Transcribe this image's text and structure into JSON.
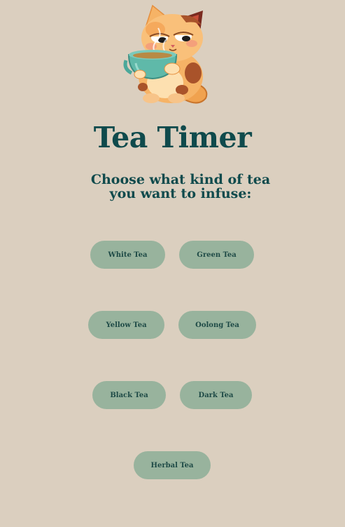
{
  "title": "Tea Timer",
  "subtitle": "Choose what kind of tea you want to infuse:",
  "teas": {
    "white": "White Tea",
    "green": "Green Tea",
    "yellow": "Yellow Tea",
    "oolong": "Oolong Tea",
    "black": "Black Tea",
    "dark": "Dark Tea",
    "herbal": "Herbal Tea"
  },
  "colors": {
    "background": "#dbcfbf",
    "heading": "#0f4a4c",
    "button": "#98b39d",
    "button_text": "#1e4a46"
  },
  "icons": {
    "mascot": "cat-with-tea-cup-icon"
  }
}
